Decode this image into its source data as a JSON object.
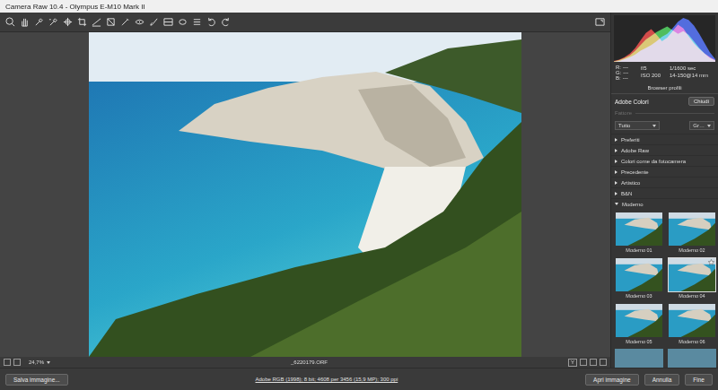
{
  "window": {
    "title": "Camera Raw 10.4 - Olympus E-M10 Mark II"
  },
  "histogram": {
    "series": [
      {
        "name": "red",
        "color": "#e0322e",
        "values": [
          2,
          5,
          10,
          18,
          30,
          46,
          62,
          70,
          58,
          44,
          52,
          66,
          80,
          72,
          55,
          40,
          28,
          18,
          10,
          4
        ]
      },
      {
        "name": "green",
        "color": "#35c447",
        "values": [
          1,
          4,
          8,
          14,
          24,
          36,
          48,
          56,
          64,
          70,
          76,
          68,
          60,
          66,
          58,
          44,
          30,
          18,
          8,
          3
        ]
      },
      {
        "name": "blue",
        "color": "#3a5cf0",
        "values": [
          0,
          2,
          6,
          10,
          16,
          24,
          30,
          36,
          44,
          54,
          60,
          72,
          86,
          94,
          90,
          78,
          60,
          40,
          20,
          6
        ]
      }
    ]
  },
  "readout": {
    "rgb": [
      {
        "label": "R:",
        "value": "---"
      },
      {
        "label": "G:",
        "value": "---"
      },
      {
        "label": "B:",
        "value": "---"
      }
    ],
    "exif": [
      "f/5",
      "1/1600 sec",
      "ISO 200",
      "14-150@14 mm"
    ]
  },
  "profile_browser": {
    "title": "Browser profili",
    "profile": "Adobe Colori",
    "close": "Chiudi",
    "amount": {
      "label": "Fattore",
      "disabled": true
    },
    "filter": "Tutto",
    "view": "Gr…",
    "groups": [
      {
        "label": "Preferiti",
        "expanded": false
      },
      {
        "label": "Adobe Raw",
        "expanded": false
      },
      {
        "label": "Colori come da fotocamera",
        "expanded": false
      },
      {
        "label": "Precedente",
        "expanded": false
      },
      {
        "label": "Artistico",
        "expanded": false
      },
      {
        "label": "B&N",
        "expanded": false
      },
      {
        "label": "Moderno",
        "expanded": true
      }
    ],
    "thumbnails": [
      {
        "label": "Moderno 01",
        "selected": false,
        "favorite": false
      },
      {
        "label": "Moderno 02",
        "selected": false,
        "favorite": false
      },
      {
        "label": "Moderno 03",
        "selected": false,
        "favorite": false
      },
      {
        "label": "Moderno 04",
        "selected": true,
        "favorite": true
      },
      {
        "label": "Moderno 05",
        "selected": false,
        "favorite": false
      },
      {
        "label": "Moderno 06",
        "selected": false,
        "favorite": false
      }
    ]
  },
  "status": {
    "zoom": "24,7%",
    "filename": "_6220179.ORF",
    "view_toggle": "Y"
  },
  "footer": {
    "save": "Salva immagine...",
    "workflow": "Adobe RGB (1998); 8 bit; 4608 per 3456 (15,9 MP); 300 ppi",
    "buttons": [
      "Apri immagine",
      "Annulla",
      "Fine"
    ]
  }
}
